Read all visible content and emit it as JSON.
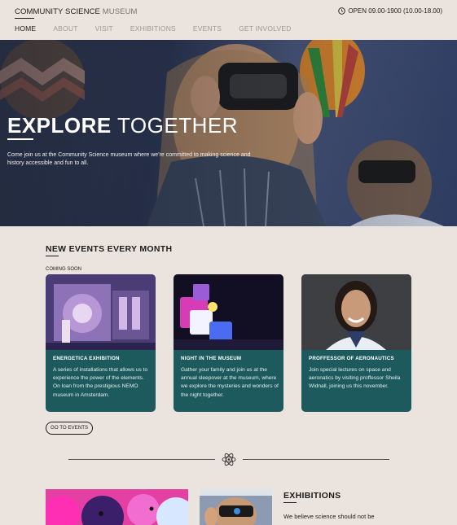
{
  "header": {
    "brand_main": "COMMUNITY SCIENCE",
    "brand_sub": "MUSEUM",
    "hours_icon": "clock-icon",
    "hours": "OPEN 09.00-1900 (10.00-18.00)"
  },
  "nav": [
    {
      "label": "HOME",
      "active": true
    },
    {
      "label": "ABOUT"
    },
    {
      "label": "VISIT"
    },
    {
      "label": "EXHIBITIONS"
    },
    {
      "label": "EVENTS"
    },
    {
      "label": "GET INVOLVED"
    }
  ],
  "hero": {
    "title_bold": "EXPLORE",
    "title_light": "TOGETHER",
    "text": "Come join us at the Community Science museum where we're committed to making science and history accessible and fun to all."
  },
  "events": {
    "title": "NEW EVENTS EVERY MONTH",
    "coming_soon": "COMING SOON",
    "cards": [
      {
        "title": "ENERGETICA EXHIBITION",
        "text": "A series of installations that allows us to experience the power of the elements. On loan from the prestigious NEMO museum in Amsterdam."
      },
      {
        "title": "NIGHT IN THE MUSEUM",
        "text": "Gather your family and join us at the annual sleepover at the museum, where we explore the mysteries and wonders of the night together."
      },
      {
        "title": "PROFFESSOR OF AERONAUTICS",
        "text": "Join special lectures on space and aeronatics by visiting proffessor Sheila Widnall, joining us this november."
      }
    ],
    "button": "GO TO EVENTS"
  },
  "divider_icon": "atom-icon",
  "exhibitions": {
    "title": "EXHIBITIONS",
    "text": "We believe science should not be"
  },
  "colors": {
    "background": "#ebe3dd",
    "card": "#1d5a5e",
    "text": "#1c1c1c",
    "muted": "#9a9a9a"
  }
}
